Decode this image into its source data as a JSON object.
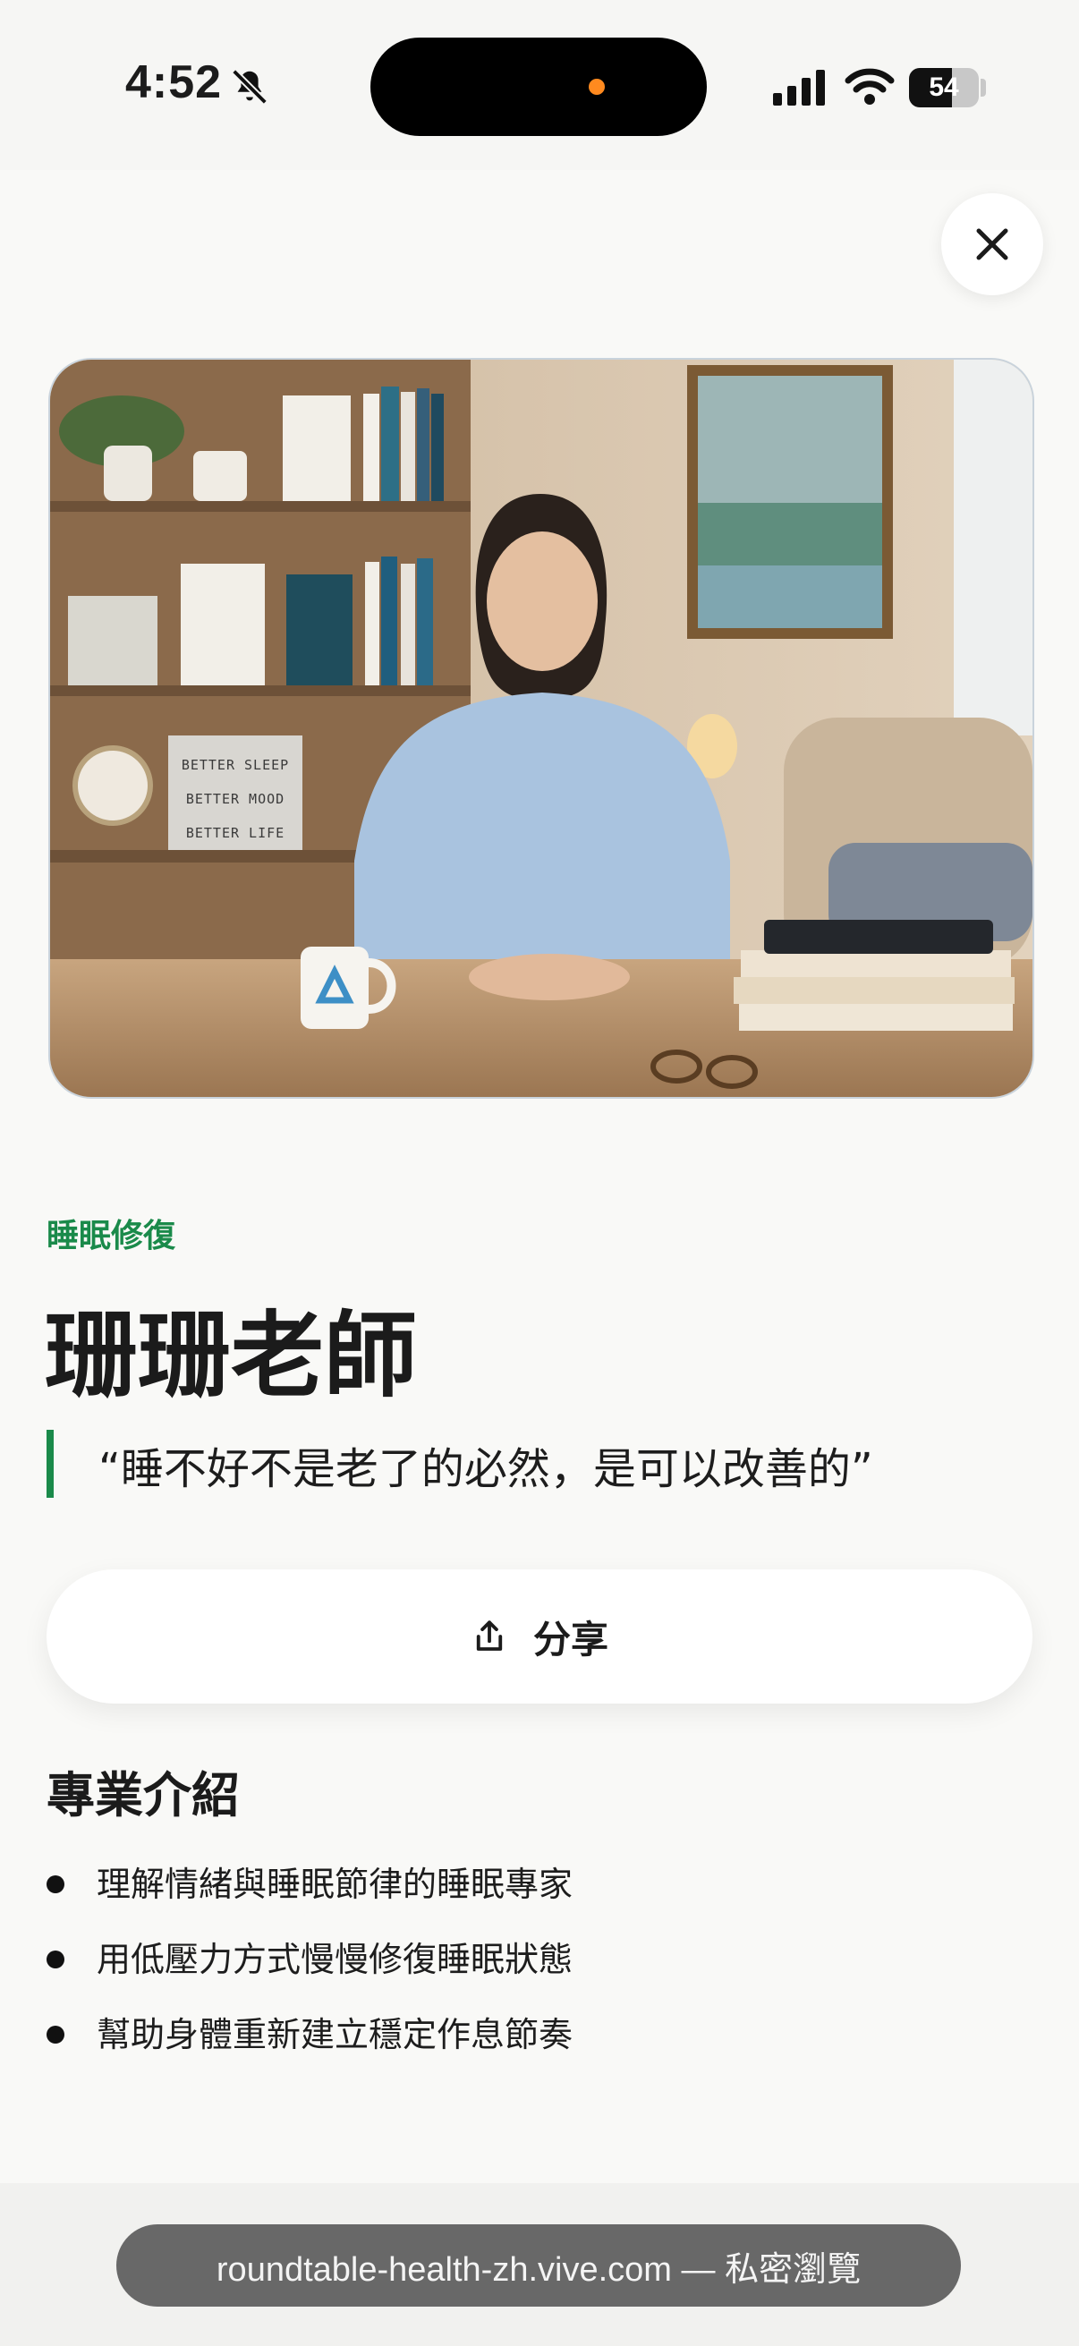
{
  "status_bar": {
    "time": "4:52",
    "battery": "54"
  },
  "profile": {
    "category": "睡眠修復",
    "name": "珊珊老師",
    "quote": "“睡不好不是老了的必然，是可以改善的”"
  },
  "share_button": {
    "label": "分享"
  },
  "intro": {
    "title": "專業介紹",
    "items": [
      "理解情緒與睡眠節律的睡眠專家",
      "用低壓力方式慢慢修復睡眠狀態",
      "幫助身體重新建立穩定作息節奏"
    ]
  },
  "hero_image": {
    "shelf_sign": [
      "BETTER SLEEP",
      "BETTER MOOD",
      "BETTER LIFE"
    ]
  },
  "browser": {
    "url": "roundtable-health-zh.vive.com — 私密瀏覽"
  },
  "colors": {
    "accent": "#1a8a4a",
    "island_dot": "#ff8a1f"
  },
  "icons": {
    "bell": "bell-slash-icon",
    "signal": "cellular-signal-icon",
    "wifi": "wifi-icon",
    "close": "close-icon",
    "share": "share-icon"
  }
}
